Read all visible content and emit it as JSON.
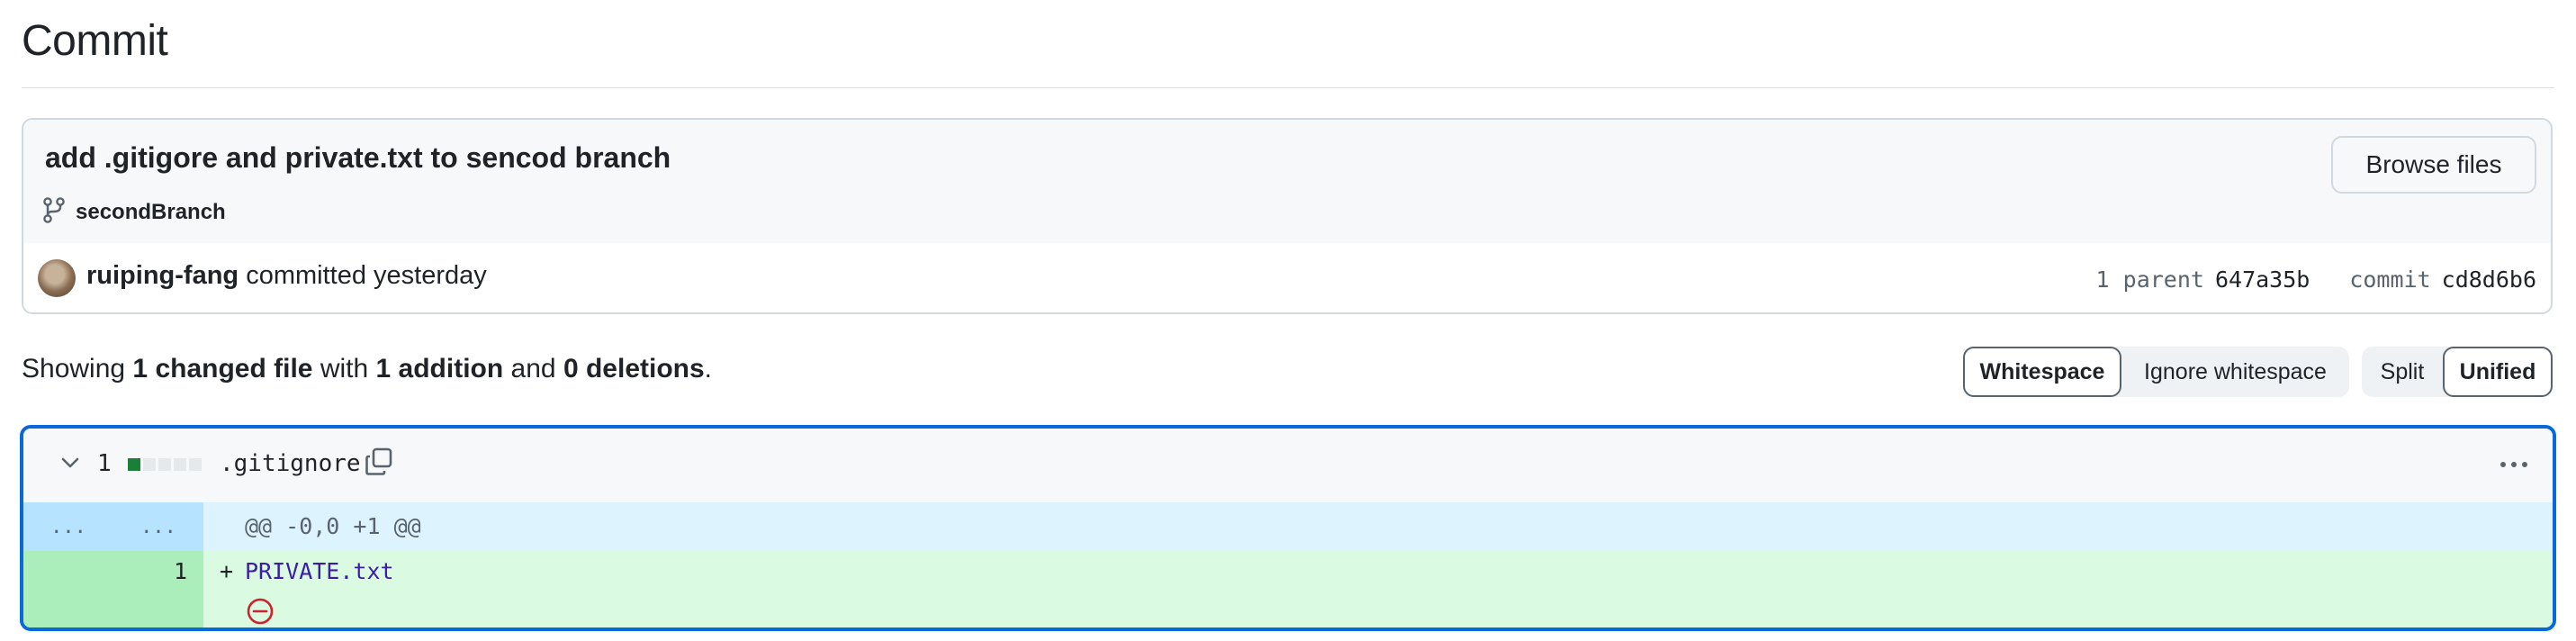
{
  "page": {
    "title": "Commit"
  },
  "commit": {
    "message": "add .gitigore and private.txt to sencod branch",
    "branch": "secondBranch",
    "browse_label": "Browse files",
    "author": "ruiping-fang",
    "action": "committed",
    "when": "yesterday",
    "parent_label": "1 parent",
    "parent_sha": "647a35b",
    "commit_label": "commit",
    "commit_sha": "cd8d6b6"
  },
  "summary": {
    "prefix": "Showing",
    "changed": "1 changed file",
    "with": "with",
    "additions": "1 addition",
    "and": "and",
    "deletions": "0 deletions",
    "end": "."
  },
  "controls": {
    "whitespace": "Whitespace",
    "ignore_whitespace": "Ignore whitespace",
    "split": "Split",
    "unified": "Unified"
  },
  "file": {
    "change_count": "1",
    "name": ".gitignore",
    "diffstat": {
      "additions": 1,
      "deletions": 0,
      "blocks": 5
    },
    "hunk_left": "...",
    "hunk_right": "...",
    "hunk_header": "@@ -0,0 +1 @@",
    "line_number": "1",
    "line_sign": "+",
    "line_text": "PRIVATE.txt"
  },
  "colors": {
    "accent": "#0969da",
    "addition_bg": "#dafbe1",
    "addition_num_bg": "#aceebb",
    "hunk_bg": "#ddf4ff",
    "diffstat_add": "#1a7f37",
    "no_newline_icon": "#cf222e"
  },
  "icons": {
    "branch": "git-branch-icon",
    "chevron": "chevron-down-icon",
    "copy": "copy-icon",
    "kebab": "kebab-horizontal-icon",
    "no_newline": "no-entry-icon"
  }
}
